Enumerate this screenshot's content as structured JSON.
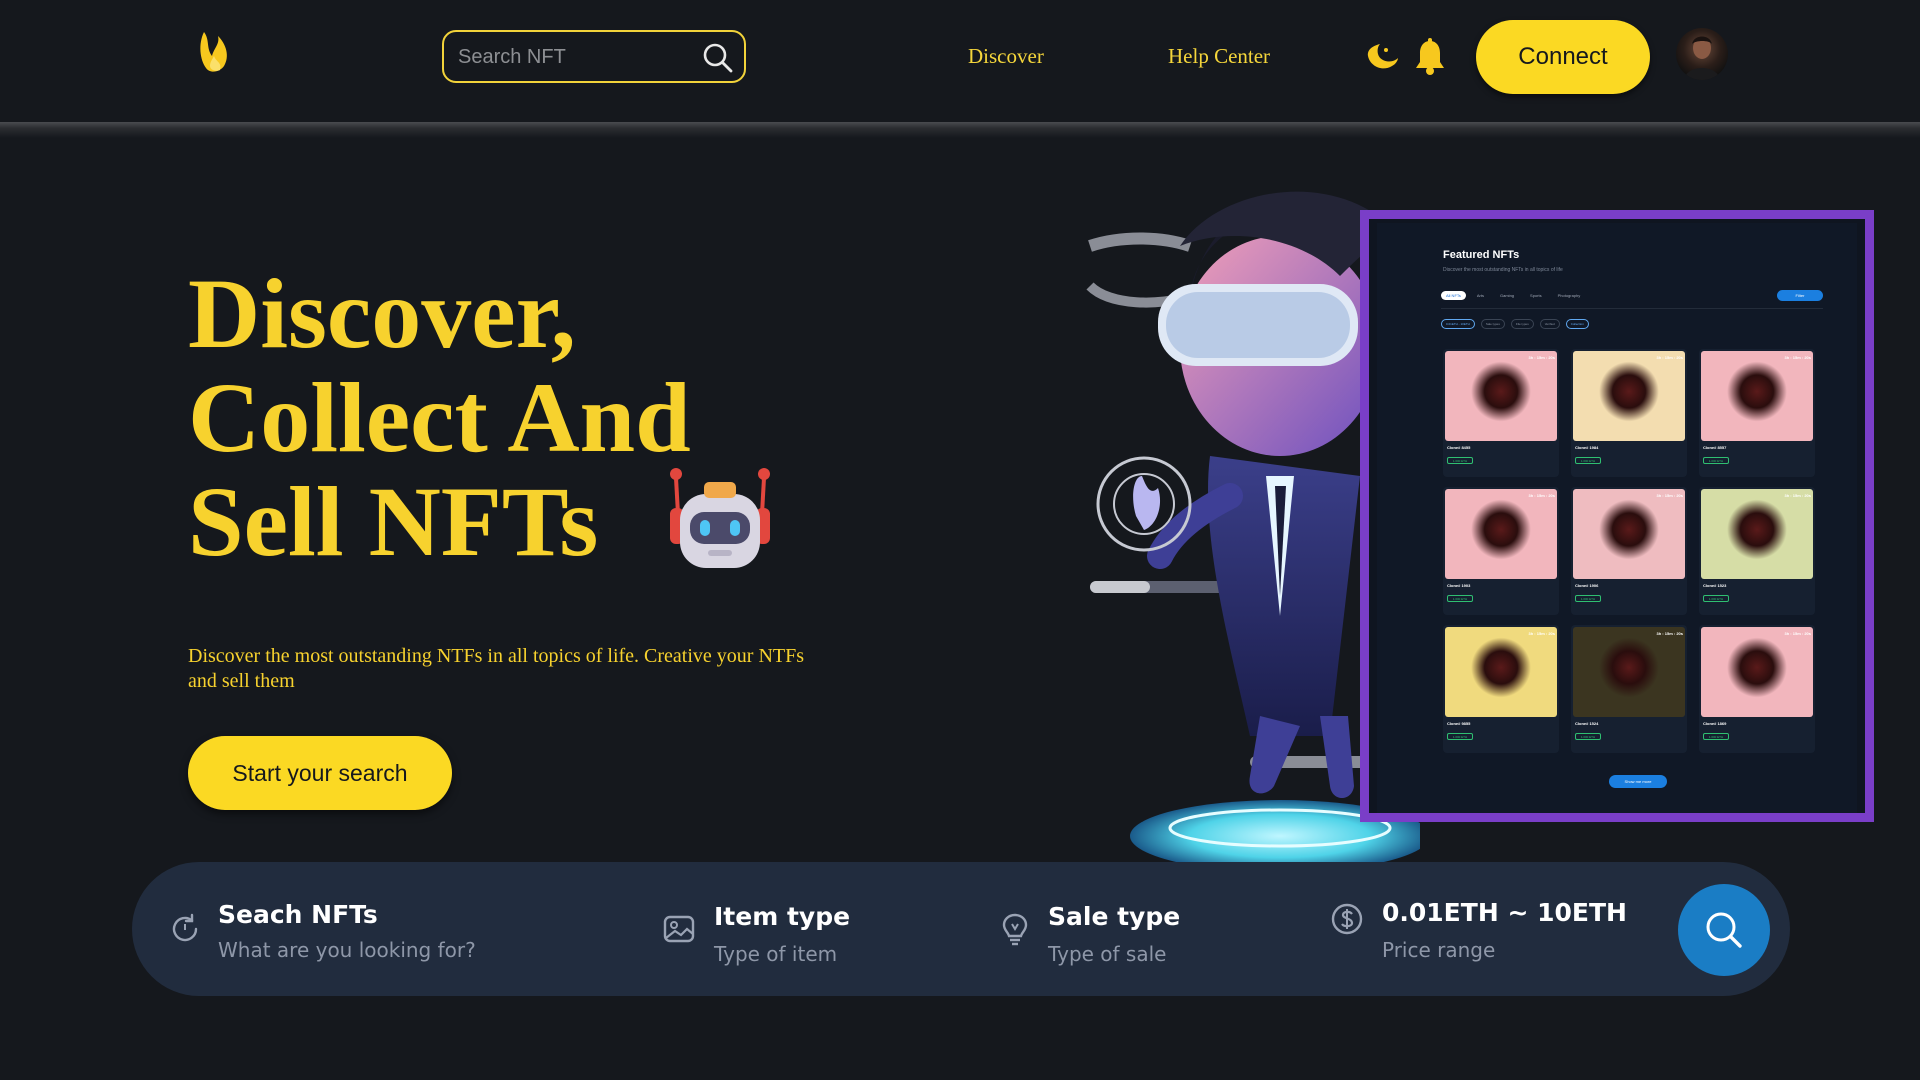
{
  "nav": {
    "search_placeholder": "Search NFT",
    "links": [
      "Discover",
      "Help Center"
    ],
    "connect_label": "Connect"
  },
  "hero": {
    "title_lines": [
      "Discover,",
      "Collect And",
      "Sell NFTs"
    ],
    "description": "Discover the most outstanding NTFs in all topics of life. Creative your NTFs and sell them",
    "cta_label": "Start your search"
  },
  "preview": {
    "title": "Featured NFTs",
    "subtitle": "Discover the most outstanding NFTs in all topics of life",
    "tabs": [
      "All NFTs",
      "Arts",
      "Gaming",
      "Sports",
      "Photography"
    ],
    "filter_label": "Filter",
    "chips": [
      "0.01ETH - 10ETH",
      "Sale types",
      "File types",
      "Verified",
      "Collection"
    ],
    "cards": [
      {
        "name": "Clone# 8455",
        "price": "1.000 ETH",
        "time": "3h : 15m : 20s",
        "color": "#f2b6bd"
      },
      {
        "name": "Clone# 1984",
        "price": "1.000 ETH",
        "time": "3h : 15m : 20s",
        "color": "#f3ddb0"
      },
      {
        "name": "Clone# 8557",
        "price": "1.000 ETH",
        "time": "3h : 15m : 20s",
        "color": "#f2b6bd"
      },
      {
        "name": "Clone# 1903",
        "price": "1.000 ETH",
        "time": "3h : 15m : 20s",
        "color": "#f2b6bd"
      },
      {
        "name": "Clone# 1906",
        "price": "1.000 ETH",
        "time": "3h : 15m : 20s",
        "color": "#efbcc0"
      },
      {
        "name": "Clone# 1523",
        "price": "1.000 ETH",
        "time": "3h : 15m : 20s",
        "color": "#d6dda6"
      },
      {
        "name": "Clone# 9855",
        "price": "1.000 ETH",
        "time": "3h : 15m : 20s",
        "color": "#f0da7e"
      },
      {
        "name": "Clone# 1524",
        "price": "1.000 ETH",
        "time": "3h : 15m : 20s",
        "color": "#3b3520"
      },
      {
        "name": "Clone# 1869",
        "price": "1.000 ETH",
        "time": "3h : 15m : 20s",
        "color": "#f2b6bd"
      }
    ],
    "show_more_label": "Show me more"
  },
  "search_panel": {
    "fields": [
      {
        "label": "Seach NFTs",
        "sub": "What are you looking for?",
        "icon": "refresh-icon"
      },
      {
        "label": "Item type",
        "sub": "Type of item",
        "icon": "image-icon"
      },
      {
        "label": "Sale type",
        "sub": "Type of sale",
        "icon": "bulb-icon"
      },
      {
        "label": "0.01ETH ~ 10ETH",
        "sub": "Price range",
        "icon": "dollar-icon"
      }
    ]
  },
  "colors": {
    "background": "#15181d",
    "accent_yellow": "#fbd923",
    "panel": "#212c3e",
    "search_button": "#1a7dc5",
    "preview_border": "#7a3ec8"
  }
}
